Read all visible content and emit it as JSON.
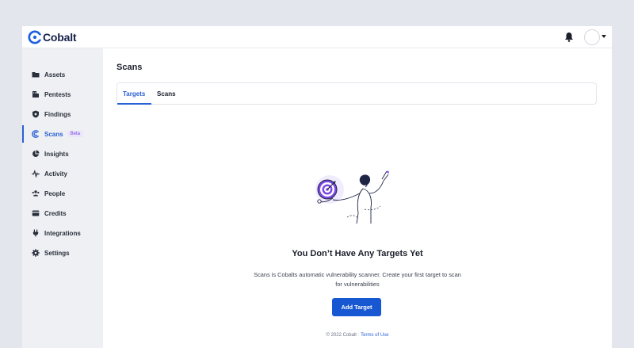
{
  "app": {
    "brand": "Cobalt"
  },
  "sidebar": {
    "items": [
      {
        "label": "Assets",
        "icon": "folder-icon"
      },
      {
        "label": "Pentests",
        "icon": "pentest-icon"
      },
      {
        "label": "Findings",
        "icon": "shield-icon"
      },
      {
        "label": "Scans",
        "icon": "scan-icon",
        "badge": "Beta",
        "active": true
      },
      {
        "label": "Insights",
        "icon": "pie-chart-icon"
      },
      {
        "label": "Activity",
        "icon": "pulse-icon"
      },
      {
        "label": "People",
        "icon": "people-icon"
      },
      {
        "label": "Credits",
        "icon": "credits-icon"
      },
      {
        "label": "Integrations",
        "icon": "plug-icon"
      },
      {
        "label": "Settings",
        "icon": "gear-icon"
      }
    ]
  },
  "main": {
    "title": "Scans",
    "tabs": [
      {
        "label": "Targets",
        "active": true
      },
      {
        "label": "Scans"
      }
    ],
    "empty_state": {
      "title": "You Don’t Have Any Targets Yet",
      "description": "Scans is Cobalts automatic vulnerability scanner. Create your first target to scan for vulnerabilities",
      "button_label": "Add Target"
    },
    "footer": {
      "copyright": "© 2022 Cobalt · ",
      "link": "Terms of Use"
    }
  },
  "colors": {
    "accent": "#2a61d6",
    "button": "#1757d2",
    "badge_bg": "#ece4fb",
    "badge_text": "#7a4fd6"
  }
}
